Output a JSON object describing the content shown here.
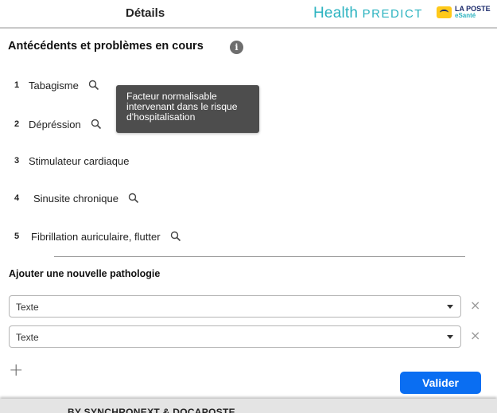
{
  "header": {
    "title": "Détails",
    "brand_main": "Health",
    "brand_sub": "PREDICT",
    "partner_line1": "LA POSTE",
    "partner_line2": "eSanté",
    "accent_color": "#2bb3c0"
  },
  "section": {
    "title": "Antécédents et problèmes en cours",
    "info_icon": "info-icon"
  },
  "items": [
    {
      "num": "1",
      "label": "Tabagisme",
      "icon": "search-icon"
    },
    {
      "num": "2",
      "label": "Dépréssion",
      "icon": "search-icon"
    },
    {
      "num": "3",
      "label": "Stimulateur cardiaque"
    },
    {
      "num": "4",
      "label": "Sinusite chronique",
      "icon": "search-icon"
    },
    {
      "num": "5",
      "label": "Fibrillation auriculaire, flutter",
      "icon": "search-icon"
    }
  ],
  "tooltip": {
    "line1": "Facteur normalisable",
    "line2": "intervenant dans le risque",
    "line3": "d'hospitalisation"
  },
  "add": {
    "title": "Ajouter une nouvelle pathologie",
    "selects": [
      {
        "value": "Texte"
      },
      {
        "value": "Texte"
      }
    ],
    "remove_symbol": "×",
    "add_symbol": "+",
    "submit_label": "Valider",
    "submit_color": "#0a6ef2"
  },
  "footer": {
    "text": "BY SYNCHRONEXT & DOCAPOSTE"
  }
}
